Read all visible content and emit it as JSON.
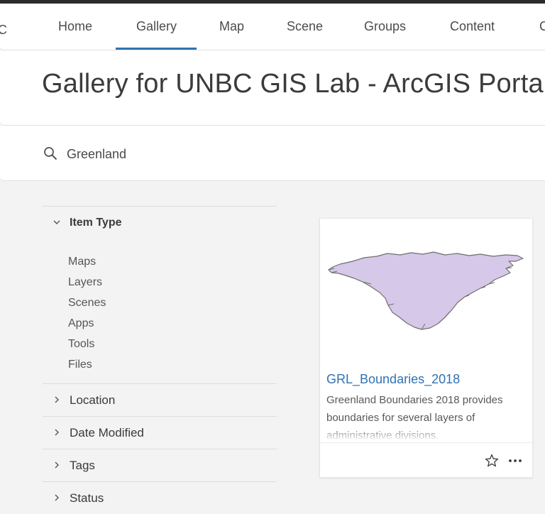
{
  "nav": {
    "edge_glyph": "C",
    "items": [
      {
        "label": "Home"
      },
      {
        "label": "Gallery",
        "active": true
      },
      {
        "label": "Map"
      },
      {
        "label": "Scene"
      },
      {
        "label": "Groups"
      },
      {
        "label": "Content"
      },
      {
        "label": "C"
      }
    ]
  },
  "page": {
    "title": "Gallery for UNBC GIS Lab - ArcGIS Portal"
  },
  "search": {
    "value": "Greenland",
    "icon": "search-icon"
  },
  "filters": {
    "item_type": {
      "label": "Item Type",
      "expanded": true,
      "options": [
        "Maps",
        "Layers",
        "Scenes",
        "Apps",
        "Tools",
        "Files"
      ]
    },
    "sections": [
      {
        "label": "Location"
      },
      {
        "label": "Date Modified"
      },
      {
        "label": "Tags"
      },
      {
        "label": "Status"
      }
    ]
  },
  "results": [
    {
      "title": "GRL_Boundaries_2018",
      "description": "Greenland Boundaries 2018 provides boundaries for several layers of administrative divisions.",
      "thumbnail": "greenland-map",
      "actions": [
        "star-icon",
        "more-icon"
      ]
    }
  ],
  "colors": {
    "accent": "#2f73b3",
    "page_bg": "#f3f3f3",
    "map_fill": "#d6c8e8",
    "map_stroke": "#6f6f6f"
  }
}
